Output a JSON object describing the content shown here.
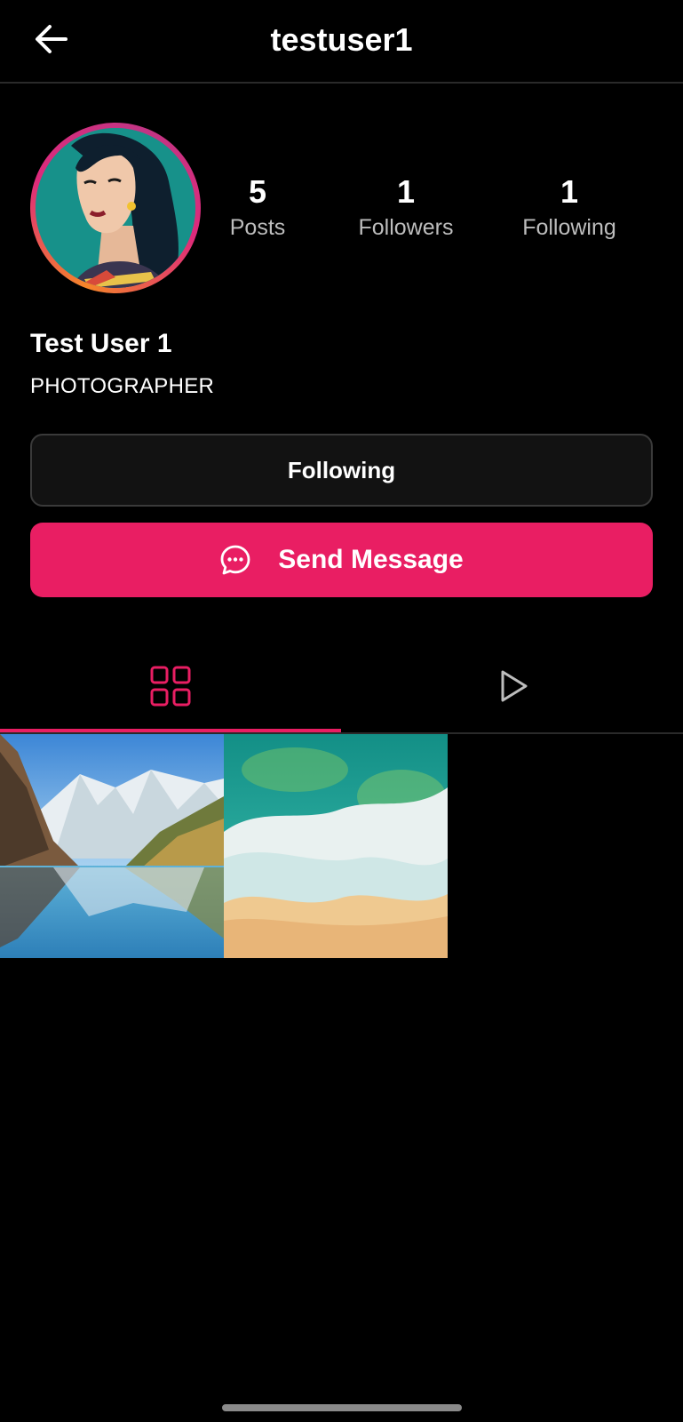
{
  "header": {
    "title": "testuser1",
    "back_icon": "arrow-left-icon"
  },
  "profile": {
    "display_name": "Test User 1",
    "bio": "PHOTOGRAPHER",
    "avatar_icon": "avatar-illustration"
  },
  "stats": [
    {
      "value": "5",
      "label": "Posts"
    },
    {
      "value": "1",
      "label": "Followers"
    },
    {
      "value": "1",
      "label": "Following"
    }
  ],
  "actions": {
    "following_label": "Following",
    "message_label": "Send Message",
    "message_icon": "chat-bubble-icon"
  },
  "tabs": [
    {
      "icon": "grid-icon",
      "active": true
    },
    {
      "icon": "play-icon",
      "active": false
    }
  ],
  "posts": [
    {
      "image": "mountain-lake-photo"
    },
    {
      "image": "beach-waves-photo"
    }
  ],
  "colors": {
    "accent": "#e91e63",
    "background": "#000000"
  }
}
